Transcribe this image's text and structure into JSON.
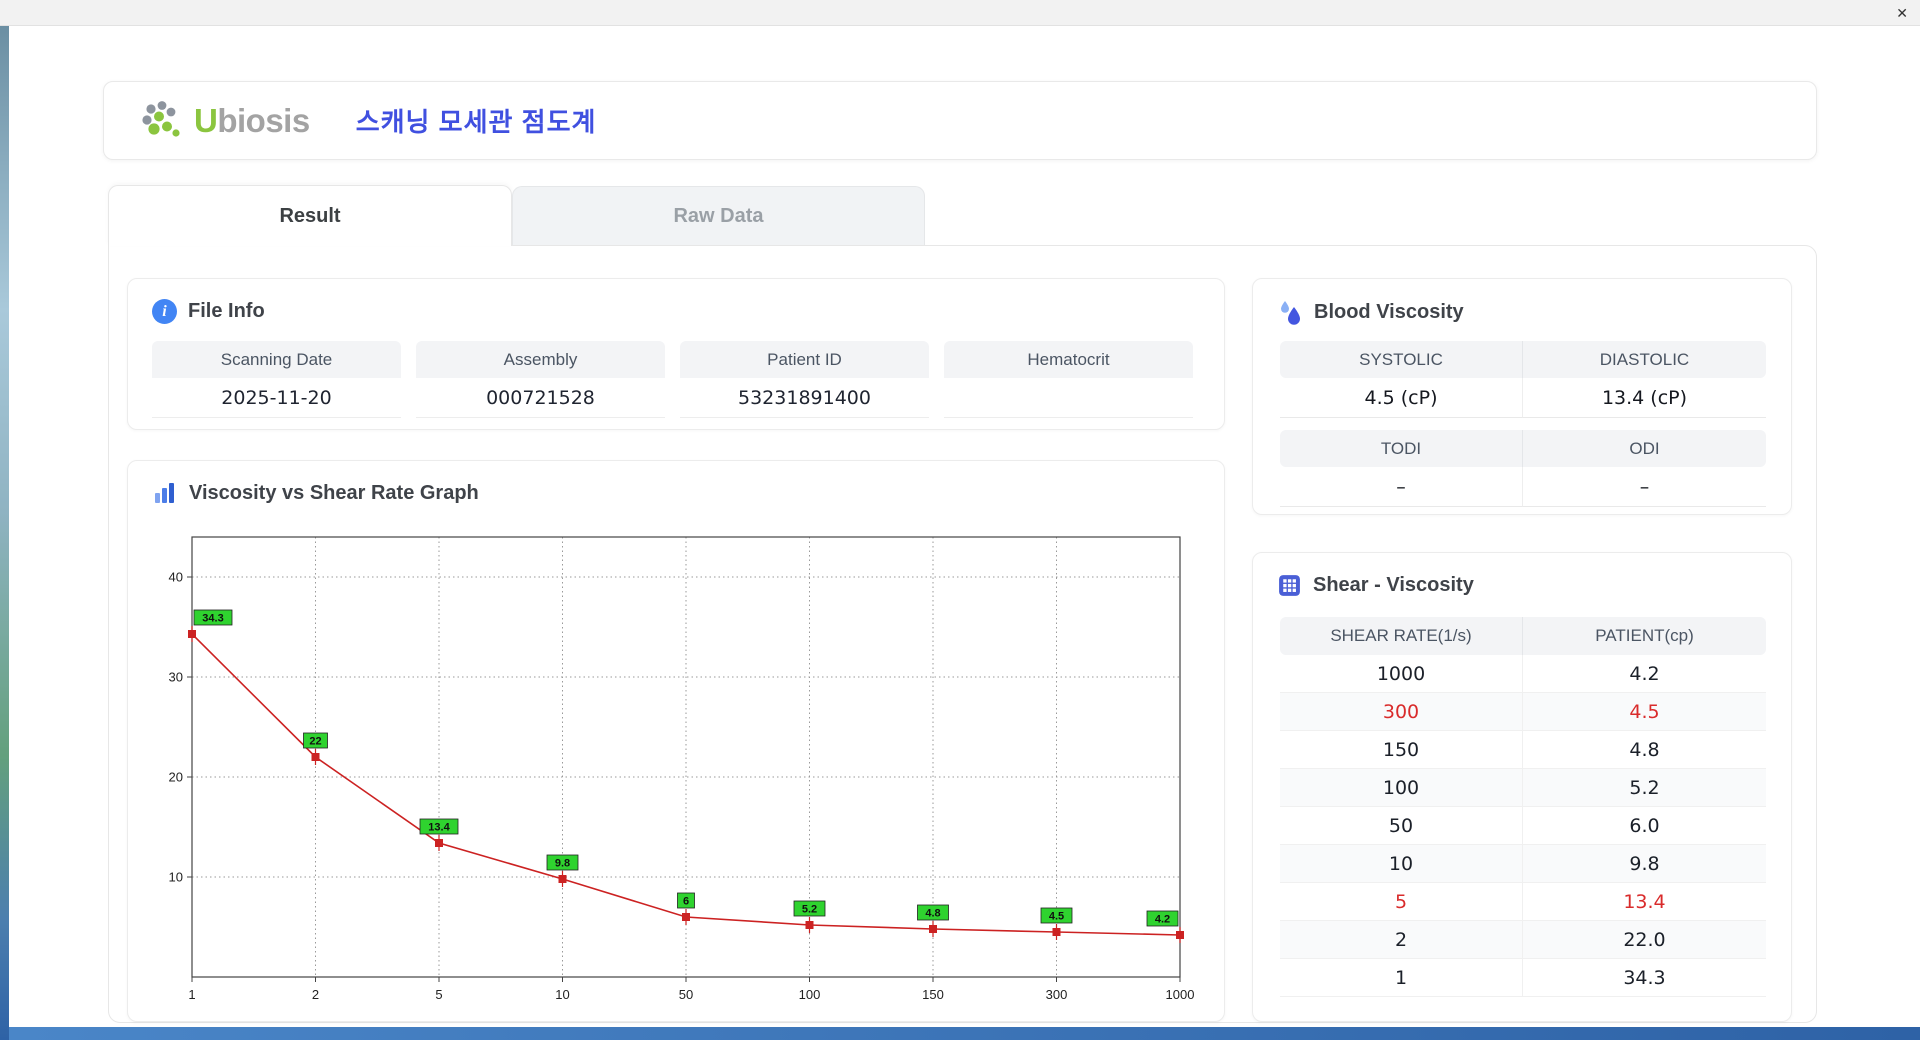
{
  "window": {
    "close_glyph": "✕"
  },
  "header": {
    "logo_u": "U",
    "logo_rest": "biosis",
    "title": "스캐닝 모세관 점도계"
  },
  "tabs": [
    {
      "label": "Result",
      "active": true
    },
    {
      "label": "Raw Data",
      "active": false
    }
  ],
  "file_info": {
    "title": "File Info",
    "fields": [
      {
        "label": "Scanning Date",
        "value": "2025-11-20"
      },
      {
        "label": "Assembly",
        "value": "000721528"
      },
      {
        "label": "Patient ID",
        "value": "53231891400"
      },
      {
        "label": "Hematocrit",
        "value": ""
      }
    ]
  },
  "graph": {
    "title": "Viscosity vs Shear Rate Graph"
  },
  "chart_data": {
    "type": "line",
    "title": "Viscosity vs Shear Rate Graph",
    "x_categories": [
      "1",
      "2",
      "5",
      "10",
      "50",
      "100",
      "150",
      "300",
      "1000"
    ],
    "values": [
      34.3,
      22,
      13.4,
      9.8,
      6,
      5.2,
      4.8,
      4.5,
      4.2
    ],
    "point_labels": [
      "34.3",
      "22",
      "13.4",
      "9.8",
      "6",
      "5.2",
      "4.8",
      "4.5",
      "4.2"
    ],
    "y_ticks": [
      10,
      20,
      30,
      40
    ],
    "ylim": [
      0,
      44
    ],
    "xlabel": "",
    "ylabel": "",
    "grid": "dotted",
    "line_color": "#cc2222",
    "marker_color": "#cc2222",
    "label_bg": "#2fd32f",
    "label_border": "#1a6b1a"
  },
  "blood_viscosity": {
    "title": "Blood Viscosity",
    "groups": [
      {
        "headers": [
          "SYSTOLIC",
          "DIASTOLIC"
        ],
        "values": [
          "4.5 (cP)",
          "13.4 (cP)"
        ]
      },
      {
        "headers": [
          "TODI",
          "ODI"
        ],
        "values": [
          "–",
          "–"
        ]
      }
    ]
  },
  "shear_viscosity": {
    "title": "Shear - Viscosity",
    "columns": [
      "SHEAR RATE(1/s)",
      "PATIENT(cp)"
    ],
    "rows": [
      {
        "rate": "1000",
        "value": "4.2",
        "highlight": false
      },
      {
        "rate": "300",
        "value": "4.5",
        "highlight": true
      },
      {
        "rate": "150",
        "value": "4.8",
        "highlight": false
      },
      {
        "rate": "100",
        "value": "5.2",
        "highlight": false
      },
      {
        "rate": "50",
        "value": "6.0",
        "highlight": false
      },
      {
        "rate": "10",
        "value": "9.8",
        "highlight": false
      },
      {
        "rate": "5",
        "value": "13.4",
        "highlight": true
      },
      {
        "rate": "2",
        "value": "22.0",
        "highlight": false
      },
      {
        "rate": "1",
        "value": "34.3",
        "highlight": false
      }
    ]
  },
  "colors": {
    "accent_blue": "#4285f4",
    "title_blue": "#4050e0",
    "logo_green": "#8bc53f",
    "highlight_red": "#d92b2b"
  }
}
